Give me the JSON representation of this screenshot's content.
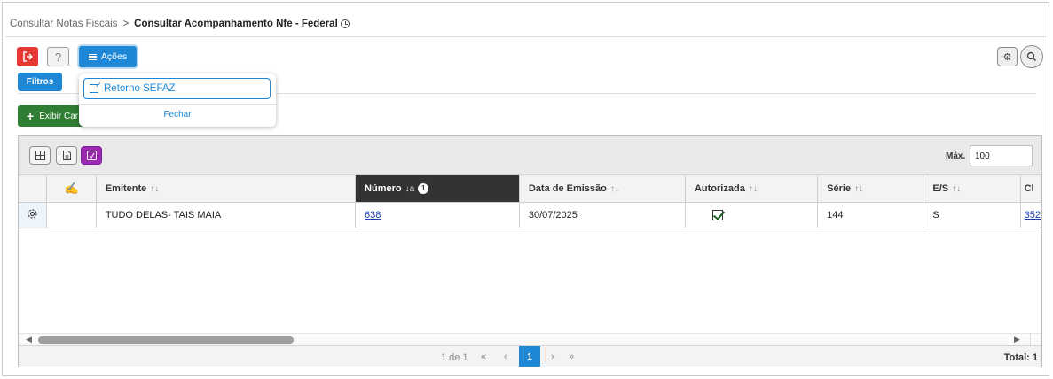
{
  "breadcrumb": {
    "parent": "Consultar Notas Fiscais",
    "separator": ">",
    "current": "Consultar Acompanhamento Nfe - Federal"
  },
  "toolbar": {
    "help_label": "?",
    "acoes_label": "Ações",
    "filtros_label": "Filtros",
    "exibir_label": "Exibir Car",
    "colors": {
      "exit": "#e53935",
      "primary": "#1e88d6",
      "success": "#2e7d32",
      "purple": "#9c27b0"
    }
  },
  "actions_menu": {
    "items": [
      {
        "label": "Retorno SEFAZ",
        "icon": "external-link-icon"
      }
    ],
    "close_label": "Fechar"
  },
  "grid": {
    "max_label": "Máx.",
    "max_value": "100",
    "columns": [
      {
        "label": ""
      },
      {
        "label": ""
      },
      {
        "label": "Emitente",
        "sort": "↑↓"
      },
      {
        "label": "Número",
        "sort": "↓a",
        "badge": "1",
        "sorted": true
      },
      {
        "label": "Data de Emissão",
        "sort": "↑↓"
      },
      {
        "label": "Autorizada",
        "sort": "↑↓"
      },
      {
        "label": "Série",
        "sort": "↑↓"
      },
      {
        "label": "E/S",
        "sort": "↑↓"
      },
      {
        "label": "Cl"
      }
    ],
    "rows": [
      {
        "emitente": "TUDO DELAS- TAIS MAIA",
        "numero": "638",
        "data_emissao": "30/07/2025",
        "autorizada": true,
        "serie": "144",
        "es": "S",
        "chave": "352"
      }
    ]
  },
  "pager": {
    "info": "1 de 1",
    "first": "«",
    "prev": "‹",
    "current": "1",
    "next": "›",
    "last": "»",
    "total": "Total: 1"
  }
}
